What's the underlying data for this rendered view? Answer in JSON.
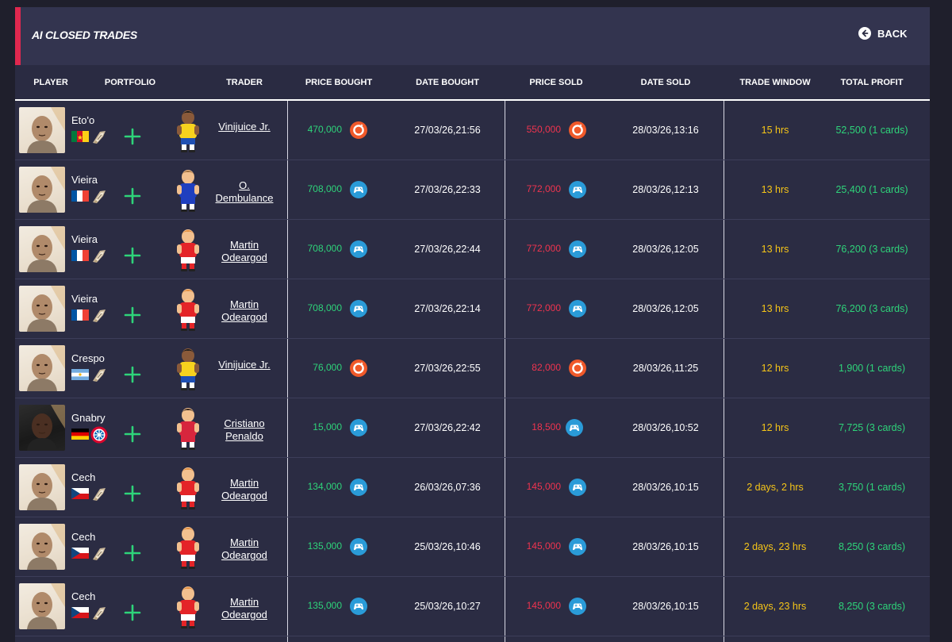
{
  "header": {
    "title": "AI CLOSED TRADES",
    "back_label": "BACK"
  },
  "columns": {
    "player": "PLAYER",
    "portfolio": "PORTFOLIO",
    "trader": "TRADER",
    "price_bought": "PRICE BOUGHT",
    "date_bought": "DATE BOUGHT",
    "price_sold": "PRICE SOLD",
    "date_sold": "DATE SOLD",
    "trade_window": "TRADE WINDOW",
    "total_profit": "TOTAL PROFIT"
  },
  "colors": {
    "accent": "#e0284f",
    "profit_green": "#2ed47a",
    "sold_red": "#f0344f",
    "window_yellow": "#f5c518",
    "playstation_blue": "#2a9bd8",
    "origin_orange": "#f0592a"
  },
  "rows": [
    {
      "player": "Eto'o",
      "flag": "cameroon",
      "club": "icon-badge",
      "card": "light",
      "trader": [
        "Vinijuice Jr."
      ],
      "avatar": "brazil",
      "price_bought": "470,000",
      "platform_bought": "origin-icon",
      "date_bought": "27/03/26,21:56",
      "price_sold": "550,000",
      "platform_sold": "origin-icon",
      "date_sold": "28/03/26,13:16",
      "trade_window": "15 hrs",
      "total_profit": "52,500 (1 cards)"
    },
    {
      "player": "Vieira",
      "flag": "france",
      "club": "icon-badge",
      "card": "light",
      "trader": [
        "O.",
        "Dembulance"
      ],
      "avatar": "blue",
      "price_bought": "708,000",
      "platform_bought": "playstation-icon",
      "date_bought": "27/03/26,22:33",
      "price_sold": "772,000",
      "platform_sold": "playstation-icon",
      "date_sold": "28/03/26,12:13",
      "trade_window": "13 hrs",
      "total_profit": "25,400 (1 cards)"
    },
    {
      "player": "Vieira",
      "flag": "france",
      "club": "icon-badge",
      "card": "light",
      "trader": [
        "Martin",
        "Odeargod"
      ],
      "avatar": "red",
      "price_bought": "708,000",
      "platform_bought": "playstation-icon",
      "date_bought": "27/03/26,22:44",
      "price_sold": "772,000",
      "platform_sold": "playstation-icon",
      "date_sold": "28/03/26,12:05",
      "trade_window": "13 hrs",
      "total_profit": "76,200 (3 cards)"
    },
    {
      "player": "Vieira",
      "flag": "france",
      "club": "icon-badge",
      "card": "light",
      "trader": [
        "Martin",
        "Odeargod"
      ],
      "avatar": "red",
      "price_bought": "708,000",
      "platform_bought": "playstation-icon",
      "date_bought": "27/03/26,22:14",
      "price_sold": "772,000",
      "platform_sold": "playstation-icon",
      "date_sold": "28/03/26,12:05",
      "trade_window": "13 hrs",
      "total_profit": "76,200 (3 cards)"
    },
    {
      "player": "Crespo",
      "flag": "argentina",
      "club": "icon-badge",
      "card": "light",
      "trader": [
        "Vinijuice Jr."
      ],
      "avatar": "brazil",
      "price_bought": "76,000",
      "platform_bought": "origin-icon",
      "date_bought": "27/03/26,22:55",
      "price_sold": "82,000",
      "platform_sold": "origin-icon",
      "date_sold": "28/03/26,11:25",
      "trade_window": "12 hrs",
      "total_profit": "1,900 (1 cards)"
    },
    {
      "player": "Gnabry",
      "flag": "germany",
      "club": "bayern-badge",
      "card": "dark",
      "trader": [
        "Cristiano",
        "Penaldo"
      ],
      "avatar": "red-dark",
      "price_bought": "15,000",
      "platform_bought": "playstation-icon",
      "date_bought": "27/03/26,22:42",
      "price_sold": "18,500",
      "platform_sold": "playstation-icon",
      "date_sold": "28/03/26,10:52",
      "trade_window": "12 hrs",
      "total_profit": "7,725 (3 cards)"
    },
    {
      "player": "Cech",
      "flag": "czech",
      "club": "icon-badge",
      "card": "light",
      "trader": [
        "Martin",
        "Odeargod"
      ],
      "avatar": "red",
      "price_bought": "134,000",
      "platform_bought": "playstation-icon",
      "date_bought": "26/03/26,07:36",
      "price_sold": "145,000",
      "platform_sold": "playstation-icon",
      "date_sold": "28/03/26,10:15",
      "trade_window": "2 days, 2 hrs",
      "total_profit": "3,750 (1 cards)"
    },
    {
      "player": "Cech",
      "flag": "czech",
      "club": "icon-badge",
      "card": "light",
      "trader": [
        "Martin",
        "Odeargod"
      ],
      "avatar": "red",
      "price_bought": "135,000",
      "platform_bought": "playstation-icon",
      "date_bought": "25/03/26,10:46",
      "price_sold": "145,000",
      "platform_sold": "playstation-icon",
      "date_sold": "28/03/26,10:15",
      "trade_window": "2 days, 23 hrs",
      "total_profit": "8,250 (3 cards)"
    },
    {
      "player": "Cech",
      "flag": "czech",
      "club": "icon-badge",
      "card": "light",
      "trader": [
        "Martin",
        "Odeargod"
      ],
      "avatar": "red",
      "price_bought": "135,000",
      "platform_bought": "playstation-icon",
      "date_bought": "25/03/26,10:27",
      "price_sold": "145,000",
      "platform_sold": "playstation-icon",
      "date_sold": "28/03/26,10:15",
      "trade_window": "2 days, 23 hrs",
      "total_profit": "8,250 (3 cards)"
    }
  ]
}
